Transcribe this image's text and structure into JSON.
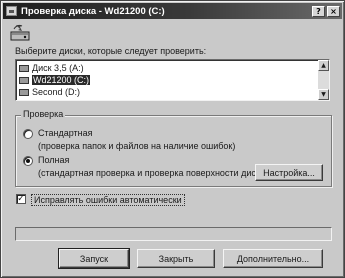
{
  "window": {
    "title": "Проверка диска - Wd21200 (C:)",
    "buttons": {
      "help": "?",
      "close": "×"
    }
  },
  "select_label": "Выберите диски, которые следует проверить:",
  "drives": [
    {
      "label": "Диск 3,5 (A:)",
      "selected": false
    },
    {
      "label": "Wd21200 (C:)",
      "selected": true
    },
    {
      "label": "Second (D:)",
      "selected": false
    }
  ],
  "scroll": {
    "up": "▲",
    "down": "▼"
  },
  "check_group": {
    "label": "Проверка",
    "standard": {
      "title": "Стандартная",
      "description": "(проверка папок и файлов на наличие ошибок)",
      "checked": false
    },
    "full": {
      "title": "Полная",
      "description": "(стандартная проверка и проверка поверхности диска)",
      "checked": true
    },
    "settings_button": "Настройка..."
  },
  "auto_fix": {
    "label": "Исправлять ошибки автоматически",
    "checked": true,
    "mark": "✓"
  },
  "buttons": {
    "start": "Запуск",
    "close": "Закрыть",
    "advanced": "Дополнительно..."
  }
}
